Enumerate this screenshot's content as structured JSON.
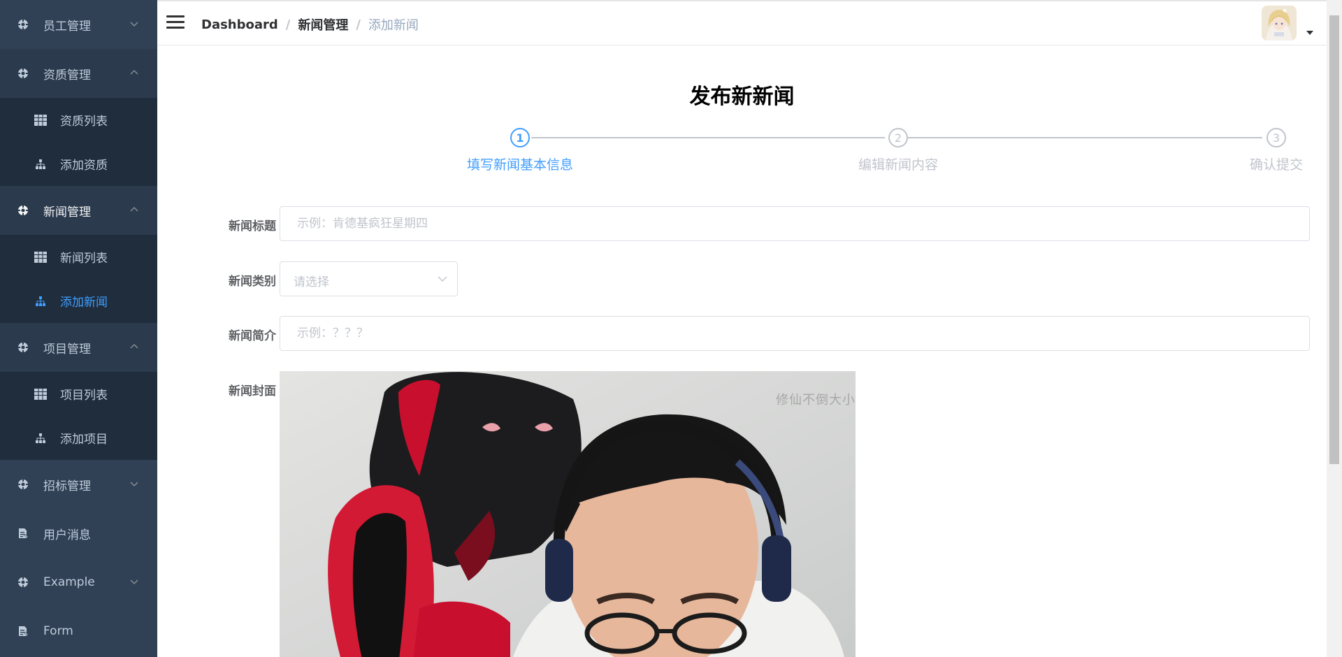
{
  "sidebar": {
    "items": [
      {
        "label": "员工管理",
        "type": "group",
        "expanded": false
      },
      {
        "label": "资质管理",
        "type": "group",
        "expanded": true,
        "children": [
          {
            "label": "资质列表",
            "icon": "table-icon"
          },
          {
            "label": "添加资质",
            "icon": "tree-icon"
          }
        ]
      },
      {
        "label": "新闻管理",
        "type": "group",
        "expanded": true,
        "children": [
          {
            "label": "新闻列表",
            "icon": "table-icon"
          },
          {
            "label": "添加新闻",
            "icon": "tree-icon",
            "active": true
          }
        ]
      },
      {
        "label": "项目管理",
        "type": "group",
        "expanded": true,
        "children": [
          {
            "label": "项目列表",
            "icon": "table-icon"
          },
          {
            "label": "添加项目",
            "icon": "tree-icon"
          }
        ]
      },
      {
        "label": "招标管理",
        "type": "group",
        "expanded": false
      },
      {
        "label": "用户消息",
        "type": "link"
      },
      {
        "label": "Example",
        "type": "group",
        "expanded": false
      },
      {
        "label": "Form",
        "type": "link"
      }
    ]
  },
  "header": {
    "breadcrumb": [
      "Dashboard",
      "新闻管理",
      "添加新闻"
    ]
  },
  "main": {
    "title": "发布新新闻",
    "steps": [
      {
        "number": "1",
        "label": "填写新闻基本信息",
        "active": true
      },
      {
        "number": "2",
        "label": "编辑新闻内容",
        "active": false
      },
      {
        "number": "3",
        "label": "确认提交",
        "active": false
      }
    ],
    "form": {
      "title_label": "新闻标题",
      "title_placeholder": "示例：肯德基疯狂星期四",
      "title_value": "",
      "category_label": "新闻类别",
      "category_placeholder": "请选择",
      "summary_label": "新闻简介",
      "summary_placeholder": "示例：？？？",
      "summary_value": "",
      "cover_label": "新闻封面",
      "cover_watermark": "修仙不倒大小"
    }
  },
  "colors": {
    "sidebar_bg": "#304156",
    "submenu_bg": "#1f2d3d",
    "accent": "#409eff",
    "muted": "#c0c4cc"
  }
}
